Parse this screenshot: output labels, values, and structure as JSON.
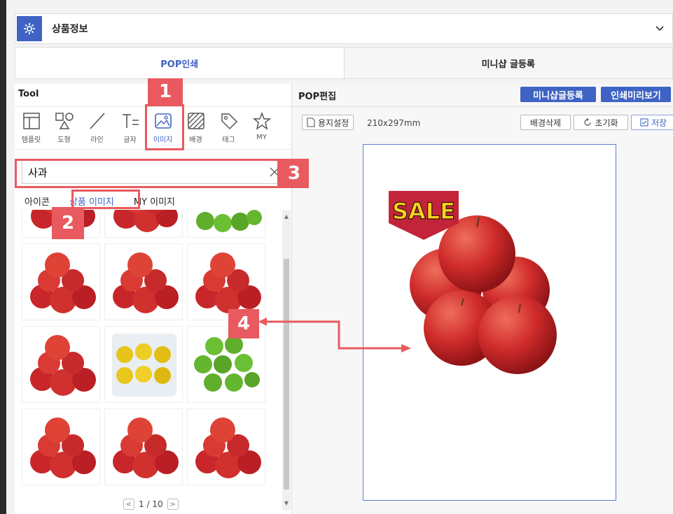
{
  "header": {
    "title": "상품정보"
  },
  "tabs": [
    {
      "label": "POP인쇄"
    },
    {
      "label": "미니샵 글등록"
    }
  ],
  "tool": {
    "title": "Tool",
    "items": [
      {
        "label": "템플릿"
      },
      {
        "label": "도형"
      },
      {
        "label": "라인"
      },
      {
        "label": "글자"
      },
      {
        "label": "이미지"
      },
      {
        "label": "배경"
      },
      {
        "label": "태그"
      },
      {
        "label": "MY"
      }
    ]
  },
  "search": {
    "value": "사과"
  },
  "subtabs": [
    {
      "label": "아이콘"
    },
    {
      "label": "상품 이미지"
    },
    {
      "label": "MY 이미지"
    }
  ],
  "pager": {
    "text": "1 / 10"
  },
  "pop": {
    "title": "POP편집",
    "btn_minishop": "미니샵글등록",
    "btn_preview": "인쇄미리보기",
    "paper_setting": "용지설정",
    "paper_size": "210x297mm",
    "remove_bg": "배경삭제",
    "reset": "초기화",
    "save": "저장",
    "sale": "SALE"
  },
  "markers": {
    "m1": "1",
    "m2": "2",
    "m3": "3",
    "m4": "4"
  },
  "colors": {
    "accent": "#3f63c4",
    "marker": "#e85a5f"
  }
}
